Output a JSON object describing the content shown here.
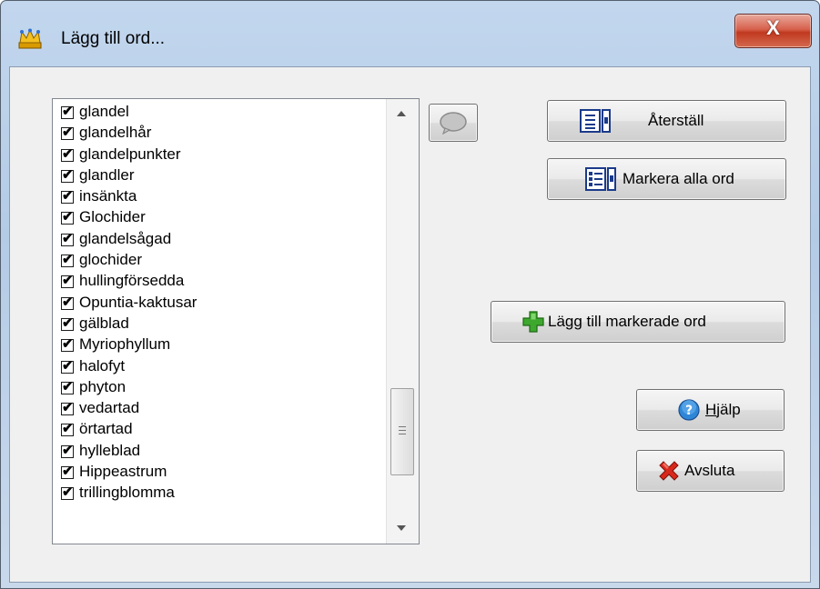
{
  "window": {
    "title": "Lägg till ord...",
    "close_label": "X"
  },
  "word_list": {
    "items": [
      {
        "label": "glandel",
        "checked": true
      },
      {
        "label": "glandelhår",
        "checked": true
      },
      {
        "label": "glandelpunkter",
        "checked": true
      },
      {
        "label": "glandler",
        "checked": true
      },
      {
        "label": "insänkta",
        "checked": true
      },
      {
        "label": "Glochider",
        "checked": true
      },
      {
        "label": "glandelsågad",
        "checked": true
      },
      {
        "label": "glochider",
        "checked": true
      },
      {
        "label": "hullingförsedda",
        "checked": true
      },
      {
        "label": "Opuntia-kaktusar",
        "checked": true
      },
      {
        "label": "gälblad",
        "checked": true
      },
      {
        "label": "Myriophyllum",
        "checked": true
      },
      {
        "label": "halofyt",
        "checked": true
      },
      {
        "label": "phyton",
        "checked": true
      },
      {
        "label": "vedartad",
        "checked": true
      },
      {
        "label": "örtartad",
        "checked": true
      },
      {
        "label": "hylleblad",
        "checked": true
      },
      {
        "label": "Hippeastrum",
        "checked": true
      },
      {
        "label": "trillingblomma",
        "checked": true
      }
    ]
  },
  "buttons": {
    "reset_label": "Återställ",
    "mark_all_label": "Markera alla ord",
    "add_marked_label": "Lägg till markerade ord",
    "help_mnemonic": "H",
    "help_rest": "jälp",
    "exit_label": "Avsluta"
  }
}
